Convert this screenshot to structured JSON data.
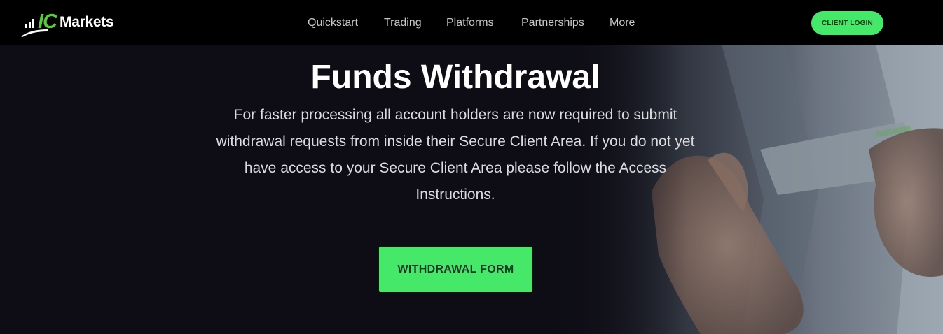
{
  "header": {
    "logo": {
      "brand_prefix": "IC",
      "brand_name": "Markets"
    },
    "nav": [
      {
        "label": "Quickstart"
      },
      {
        "label": "Trading"
      },
      {
        "label": "Platforms"
      },
      {
        "label": "Partnerships"
      },
      {
        "label": "More"
      }
    ],
    "client_login_label": "CLIENT LOGIN"
  },
  "hero": {
    "title": "Funds Withdrawal",
    "description": "For faster processing all account holders are now required to submit withdrawal requests from inside their Secure Client Area. If you do not yet have access to your Secure Client Area please follow the Access Instructions.",
    "button_label": "WITHDRAWAL FORM"
  },
  "colors": {
    "accent_green": "#46e86a",
    "logo_green": "#55cc3a",
    "header_bg": "#000000",
    "hero_bg": "#0e0d16"
  }
}
